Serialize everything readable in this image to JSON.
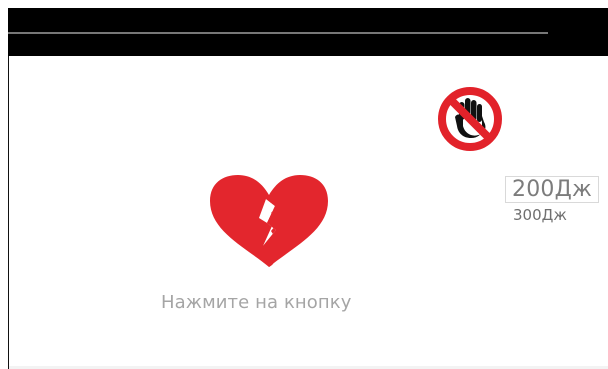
{
  "screen": {
    "prompt": "Нажмите на кнопку"
  },
  "icons": {
    "status": "broken-heart-icon",
    "warning": "no-touch-icon"
  },
  "energy": {
    "selected": "200Дж",
    "secondary": "300Дж"
  },
  "colors": {
    "heart": "#e3262d",
    "warning_ring": "#e2222a",
    "text": "#9e9e9e",
    "background": "#ffffff"
  }
}
